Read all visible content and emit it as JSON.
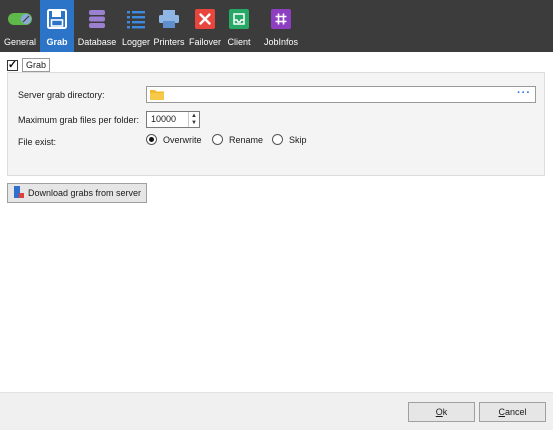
{
  "toolbar": {
    "items": [
      {
        "label": "General",
        "icon": "toggle-icon",
        "active": false
      },
      {
        "label": "Grab",
        "icon": "floppy-disk-icon",
        "active": true
      },
      {
        "label": "Database",
        "icon": "database-icon",
        "active": false
      },
      {
        "label": "Logger",
        "icon": "list-icon",
        "active": false
      },
      {
        "label": "Printers",
        "icon": "printer-icon",
        "active": false
      },
      {
        "label": "Failover",
        "icon": "close-icon",
        "active": false
      },
      {
        "label": "Client",
        "icon": "inbox-icon",
        "active": false
      },
      {
        "label": "JobInfos",
        "icon": "hash-icon",
        "active": false
      }
    ],
    "colors": {
      "bar": "#3c3c3c",
      "active": "#2b74c8"
    }
  },
  "grab": {
    "checkbox_label": "Grab",
    "checked": true,
    "server_dir_label": "Server grab directory:",
    "server_dir_value": "",
    "browse_label": "···",
    "max_files_label": "Maximum grab files per folder:",
    "max_files_value": "10000",
    "file_exist_label": "File exist:",
    "file_exist_options": [
      "Overwrite",
      "Rename",
      "Skip"
    ],
    "file_exist_selected": "Overwrite"
  },
  "download_button": "Download grabs from server",
  "footer": {
    "ok_rest": "k",
    "ok_mnemonic": "O",
    "cancel_rest": "ancel",
    "cancel_mnemonic": "C"
  }
}
